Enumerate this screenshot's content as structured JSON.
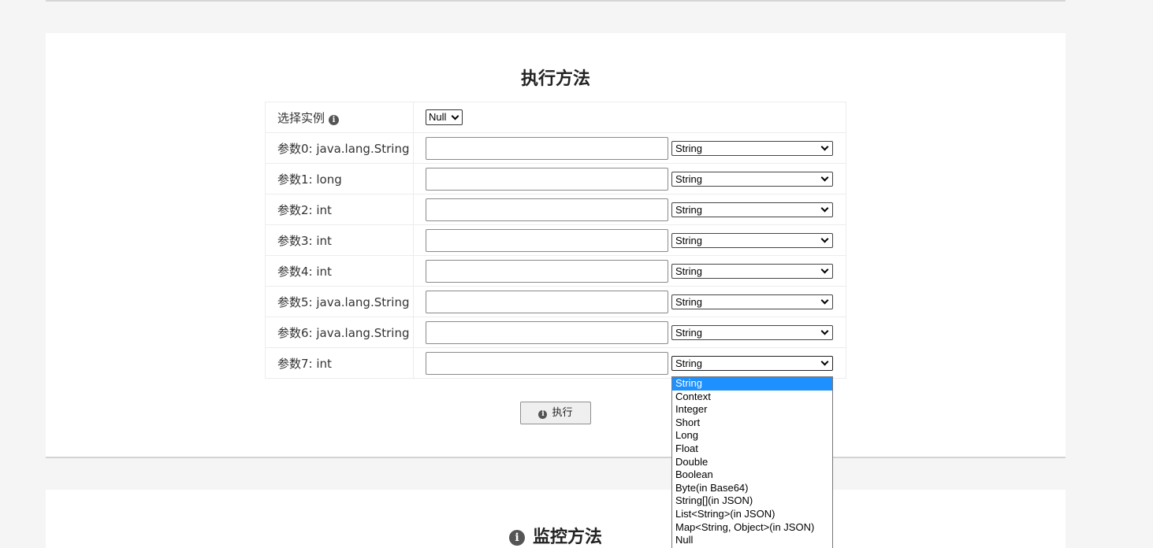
{
  "exec_panel": {
    "title": "执行方法",
    "instance_label": "选择实例",
    "instance_value": "Null",
    "params": [
      {
        "label": "参数0: java.lang.String",
        "value": "",
        "type": "String"
      },
      {
        "label": "参数1: long",
        "value": "",
        "type": "String"
      },
      {
        "label": "参数2: int",
        "value": "",
        "type": "String"
      },
      {
        "label": "参数3: int",
        "value": "",
        "type": "String"
      },
      {
        "label": "参数4: int",
        "value": "",
        "type": "String"
      },
      {
        "label": "参数5: java.lang.String",
        "value": "",
        "type": "String"
      },
      {
        "label": "参数6: java.lang.String",
        "value": "",
        "type": "String"
      },
      {
        "label": "参数7: int",
        "value": "",
        "type": "String"
      }
    ],
    "execute_label": "执行"
  },
  "type_dropdown": {
    "selected": "String",
    "options": [
      "String",
      "Context",
      "Integer",
      "Short",
      "Long",
      "Float",
      "Double",
      "Boolean",
      "Byte(in Base64)",
      "String[](in JSON)",
      "List<String>(in JSON)",
      "Map<String, Object>(in JSON)",
      "Null"
    ]
  },
  "monitor_panel": {
    "title": "监控方法"
  },
  "icons": {
    "info": "info-circle-icon",
    "chevron": "chevron-down-icon"
  },
  "colors": {
    "selected_option_bg": "#1e90ff",
    "page_bg": "#f5f5f5",
    "panel_bg": "#ffffff"
  }
}
